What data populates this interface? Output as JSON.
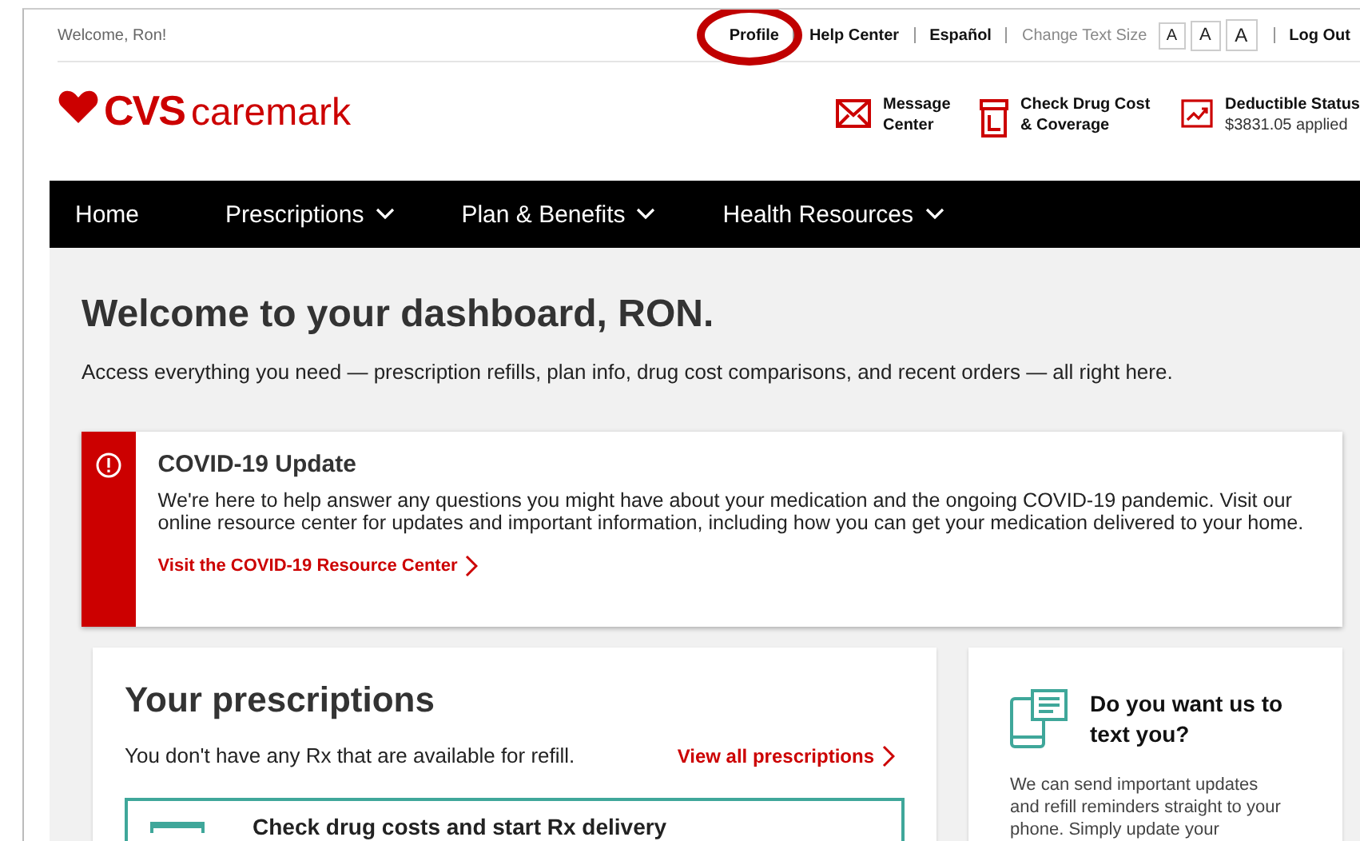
{
  "top_bar": {
    "welcome": "Welcome, Ron!",
    "links": [
      {
        "label": "Profile",
        "circled": true
      },
      {
        "label": "Help Center",
        "circled": false
      },
      {
        "label": "Español",
        "circled": false
      }
    ],
    "text_size_label": "Change Text Size",
    "text_size_buttons": [
      "A",
      "A",
      "A"
    ],
    "logout": "Log Out"
  },
  "header": {
    "logo": {
      "brand": "CVS",
      "product": "caremark"
    },
    "quick_links": [
      {
        "kind": "mail",
        "label": "Message Center"
      },
      {
        "kind": "drug",
        "label": "Check Drug Cost & Coverage"
      },
      {
        "kind": "chart",
        "label": "Deductible Status",
        "detail": "$3831.05 applied"
      }
    ]
  },
  "nav": [
    {
      "label": "Home",
      "has_menu": false
    },
    {
      "label": "Prescriptions",
      "has_menu": true
    },
    {
      "label": "Plan & Benefits",
      "has_menu": true
    },
    {
      "label": "Health Resources",
      "has_menu": true
    }
  ],
  "dashboard": {
    "title": "Welcome to your dashboard, RON.",
    "subtitle": "Access everything you need — prescription refills, plan info, drug cost comparisons, and recent orders — all right here.",
    "alert": {
      "title": "COVID-19 Update",
      "body": "We're here to help answer any questions you might have about your medication and the ongoing COVID-19 pandemic. Visit our online resource center for updates and important information, including how you can get your medication delivered to your home.",
      "link": "Visit the COVID-19 Resource Center"
    },
    "prescriptions": {
      "title": "Your prescriptions",
      "message": "You don't have any Rx that are available for refill.",
      "link": "View all prescriptions",
      "option": "Check drug costs and start Rx delivery"
    },
    "text_card": {
      "title": "Do you want us to text you?",
      "body": "We can send important updates and refill reminders straight to your phone. Simply update your"
    }
  }
}
